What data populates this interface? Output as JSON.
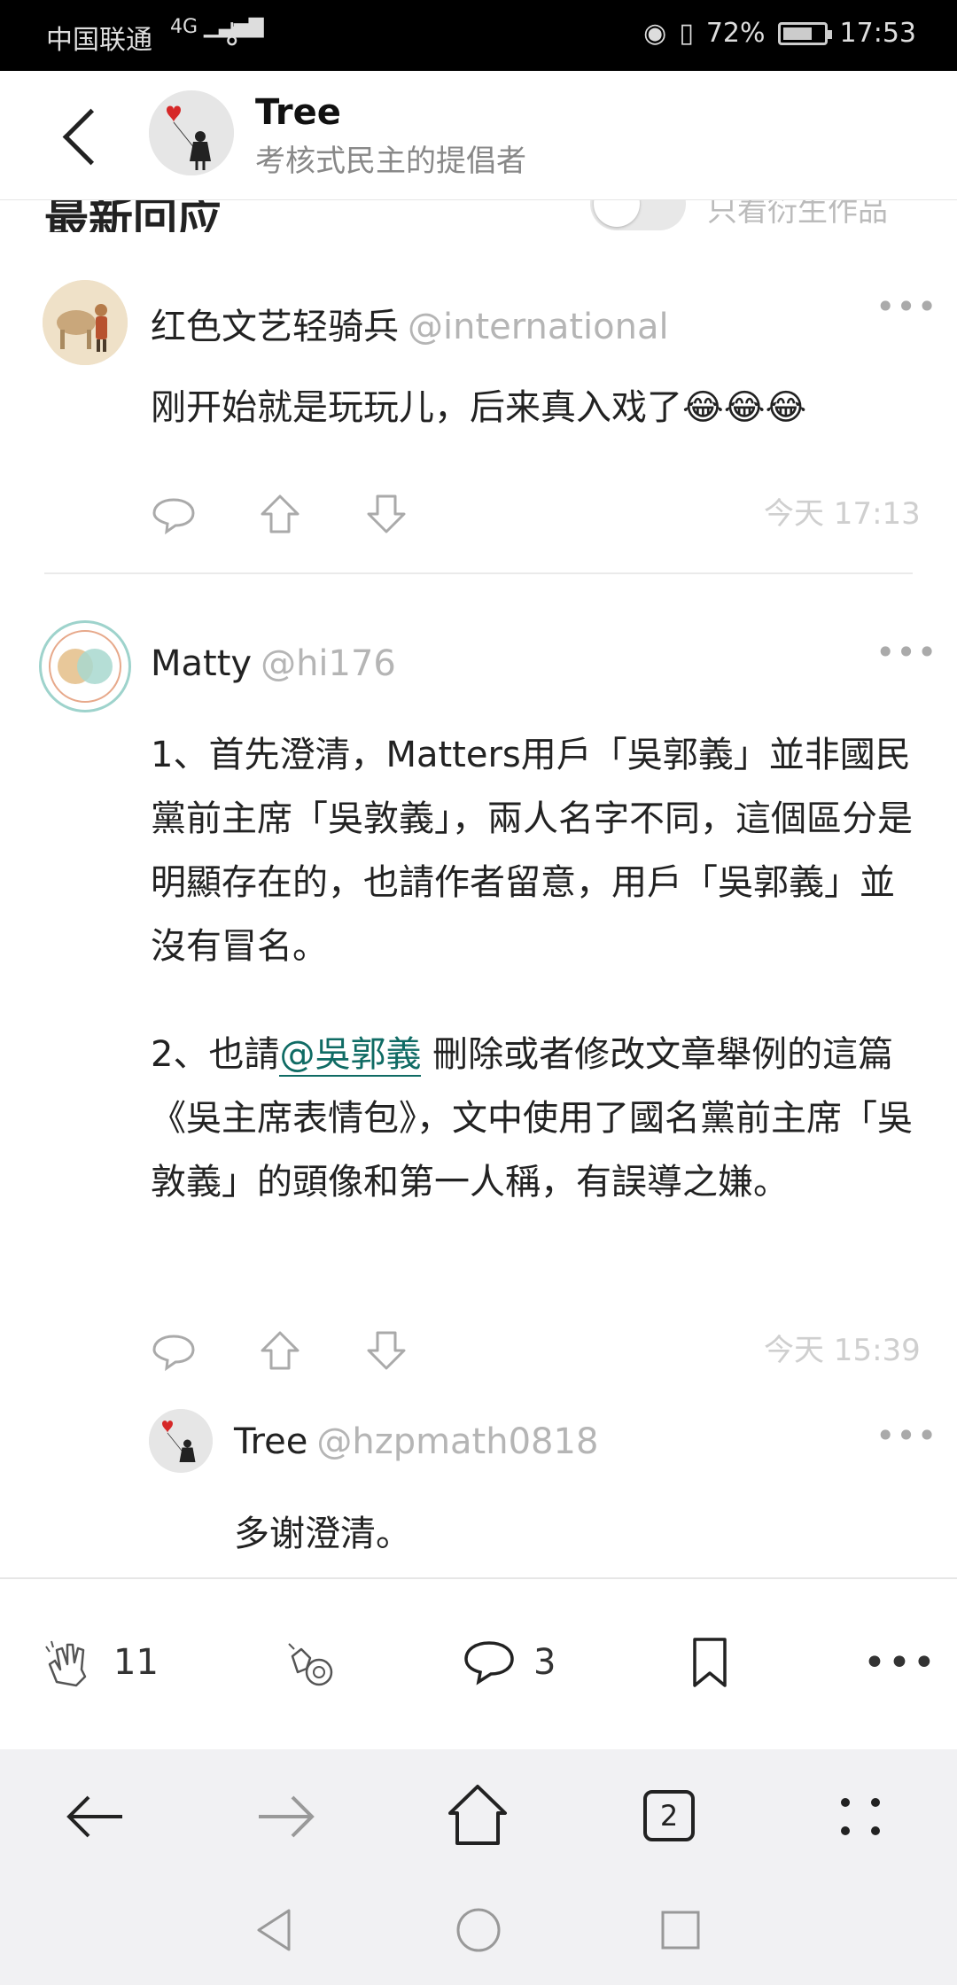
{
  "status_bar": {
    "carrier": "中国联通",
    "network": "4G",
    "battery": "72%",
    "battery_level": 0.72,
    "time": "17:53"
  },
  "header": {
    "title": "Tree",
    "subtitle": "考核式民主的提倡者"
  },
  "section": {
    "title": "最新回应",
    "toggle_label": "只看衍生作品",
    "toggle_on": false
  },
  "comments": [
    {
      "name": "红色文艺轻骑兵",
      "handle": "@international",
      "text": "刚开始就是玩玩儿，后来真入戏了😂😂😂",
      "time": "今天 17:13"
    },
    {
      "name": "Matty",
      "handle": "@hi176",
      "para1": "1、首先澄清，Matters用戶「吳郭義」並非國民黨前主席「吳敦義」，兩人名字不同，這個區分是明顯存在的，也請作者留意，用戶「吳郭義」並沒有冒名。",
      "para2_prefix": "2、也請",
      "para2_mention": "@吳郭義",
      "para2_rest": " 刪除或者修改文章舉例的這篇《吳主席表情包》，文中使用了國名黨前主席「吳敦義」的頭像和第一人稱，有誤導之嫌。",
      "time": "今天 15:39",
      "reply": {
        "name": "Tree",
        "handle": "@hzpmath0818",
        "text": "多谢澄清。"
      }
    }
  ],
  "toolbar": {
    "claps": "11",
    "comments": "3"
  },
  "browser": {
    "tab_count": "2"
  },
  "icons": {
    "more": "more-icon",
    "reply": "comment-bubble-icon",
    "upvote": "arrow-up-icon",
    "downvote": "arrow-down-icon",
    "clap": "clap-icon",
    "donate": "donate-icon",
    "bookmark": "bookmark-icon"
  }
}
